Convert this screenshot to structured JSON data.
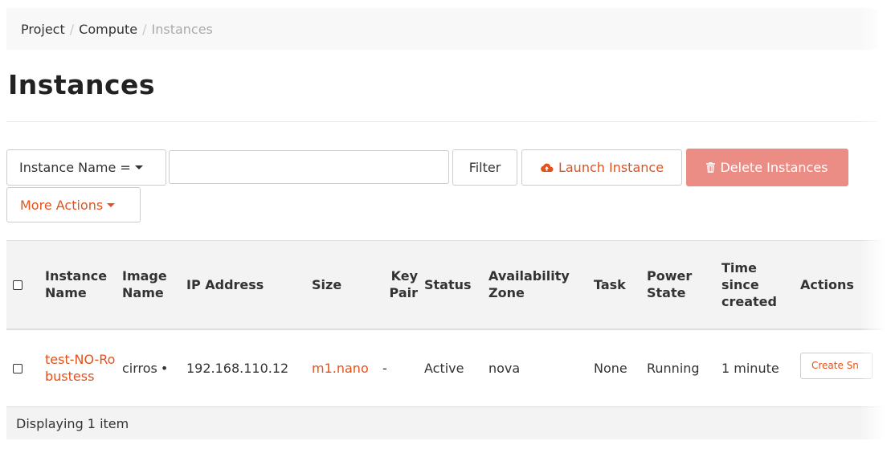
{
  "breadcrumb": {
    "items": [
      "Project",
      "Compute"
    ],
    "current": "Instances",
    "separator": "/"
  },
  "page": {
    "title": "Instances"
  },
  "toolbar": {
    "filter_field": "Instance Name =",
    "filter_value": "",
    "filter_button": "Filter",
    "launch_button": "Launch Instance",
    "delete_button": "Delete Instances",
    "more_actions": "More Actions",
    "icons": {
      "launch": "cloud-upload-icon",
      "delete": "trash-icon"
    }
  },
  "table": {
    "headers": {
      "name": "Instance Name",
      "image": "Image Name",
      "ip": "IP Address",
      "size": "Size",
      "keypair": "Key Pair",
      "status": "Status",
      "zone": "Availability Zone",
      "task": "Task",
      "power": "Power State",
      "time": "Time since created",
      "actions": "Actions"
    },
    "rows": [
      {
        "name": "test-NO-Robustess",
        "image": "cirros",
        "ip_bullet": "•",
        "ip": "192.168.110.12",
        "size": "m1.nano",
        "keypair": "-",
        "status": "Active",
        "zone": "nova",
        "task": "None",
        "power": "Running",
        "time": "1 minute",
        "action": "Create Sn"
      }
    ],
    "footer": "Displaying 1 item"
  },
  "colors": {
    "accent": "#e2521d",
    "danger_disabled": "#eb8c85",
    "header_bg": "#f3f3f3",
    "breadcrumb_bg": "#f8f8f8"
  }
}
